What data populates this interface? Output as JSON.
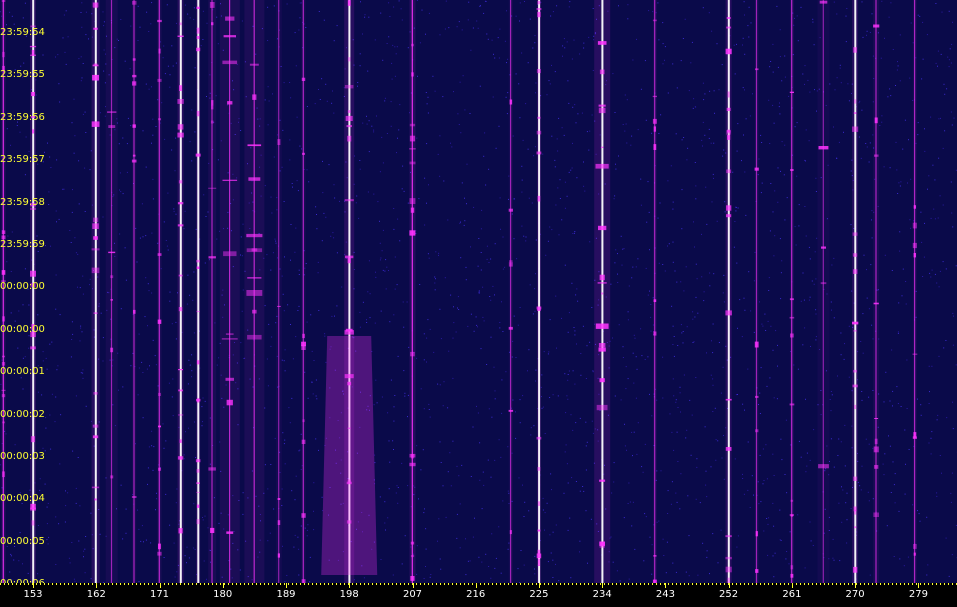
{
  "time_labels": [
    "23:59:54",
    "23:59:55",
    "23:59:56",
    "23:59:57",
    "23:59:58",
    "23:59:59",
    "00:00:00",
    "00:00:00",
    "00:00:01",
    "00:00:02",
    "00:00:03",
    "00:00:04",
    "00:00:05",
    "00:00:06"
  ],
  "freq_labels": [
    "153",
    "162",
    "171",
    "180",
    "189",
    "198",
    "207",
    "216",
    "225",
    "234",
    "243",
    "252",
    "261",
    "270",
    "279"
  ],
  "colors": {
    "background": "#0a0a4a",
    "signal": "#ff33ff",
    "signal_bright": "#ffffff",
    "axis_text": "#ffff33",
    "freq_text": "#ffffff"
  },
  "freq_range_mhz": [
    148.3,
    284.5
  ],
  "signals": [
    {
      "freq": 153.0,
      "strength": 1.0,
      "spread": 3
    },
    {
      "freq": 148.8,
      "strength": 0.8,
      "spread": 2
    },
    {
      "freq": 161.9,
      "strength": 1.0,
      "spread": 4
    },
    {
      "freq": 164.2,
      "strength": 0.4,
      "spread": 6
    },
    {
      "freq": 167.4,
      "strength": 0.5,
      "spread": 2
    },
    {
      "freq": 171.0,
      "strength": 0.6,
      "spread": 2
    },
    {
      "freq": 174.0,
      "strength": 1.0,
      "spread": 3
    },
    {
      "freq": 176.5,
      "strength": 1.0,
      "spread": 2
    },
    {
      "freq": 178.5,
      "strength": 0.5,
      "spread": 4
    },
    {
      "freq": 181.0,
      "strength": 0.6,
      "spread": 10
    },
    {
      "freq": 184.5,
      "strength": 0.6,
      "spread": 10
    },
    {
      "freq": 188.0,
      "strength": 0.3,
      "spread": 3
    },
    {
      "freq": 191.5,
      "strength": 0.5,
      "spread": 2
    },
    {
      "freq": 198.0,
      "strength": 1.0,
      "spread": 5
    },
    {
      "freq": 207.0,
      "strength": 0.9,
      "spread": 3
    },
    {
      "freq": 221.0,
      "strength": 0.4,
      "spread": 2
    },
    {
      "freq": 225.0,
      "strength": 1.0,
      "spread": 2
    },
    {
      "freq": 234.0,
      "strength": 1.0,
      "spread": 8
    },
    {
      "freq": 241.5,
      "strength": 0.5,
      "spread": 2
    },
    {
      "freq": 252.0,
      "strength": 1.0,
      "spread": 3
    },
    {
      "freq": 256.0,
      "strength": 0.4,
      "spread": 2
    },
    {
      "freq": 261.0,
      "strength": 0.6,
      "spread": 2
    },
    {
      "freq": 265.5,
      "strength": 0.3,
      "spread": 6
    },
    {
      "freq": 270.0,
      "strength": 1.0,
      "spread": 3
    },
    {
      "freq": 273.0,
      "strength": 0.5,
      "spread": 3
    },
    {
      "freq": 278.5,
      "strength": 0.5,
      "spread": 2
    }
  ]
}
